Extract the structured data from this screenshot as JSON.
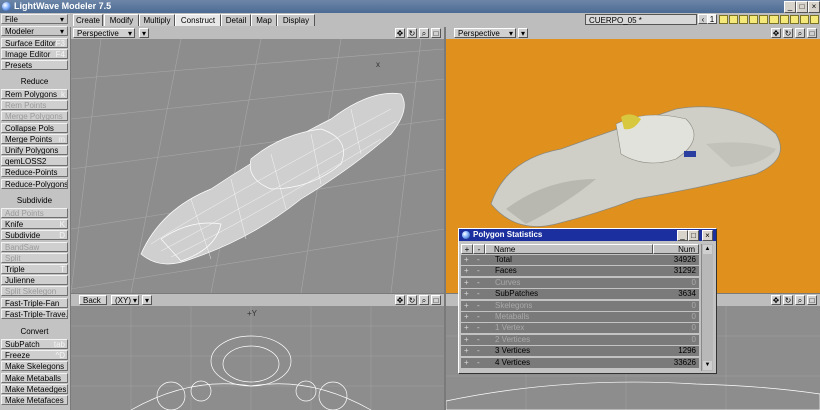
{
  "app": {
    "title": "LightWave Modeler 7.5"
  },
  "window_controls": [
    "_",
    "□",
    "×"
  ],
  "sidebar": {
    "file": "File",
    "modeler": "Modeler",
    "items": [
      {
        "label": "Surface Editor",
        "shortcut": "F3",
        "enabled": true
      },
      {
        "label": "Image Editor",
        "shortcut": "F4",
        "enabled": true
      },
      {
        "label": "Presets",
        "shortcut": "",
        "enabled": true
      }
    ],
    "sections": [
      {
        "title": "Reduce",
        "items": [
          {
            "label": "Rem Polygons",
            "shortcut": "k",
            "enabled": true
          },
          {
            "label": "Rem Points",
            "shortcut": "",
            "enabled": false
          },
          {
            "label": "Merge Polygons",
            "shortcut": "",
            "enabled": false
          },
          {
            "label": "Collapse Pols",
            "shortcut": "",
            "enabled": true
          },
          {
            "label": "Merge Points",
            "shortcut": "m",
            "enabled": true
          },
          {
            "label": "Unify Polygons",
            "shortcut": "",
            "enabled": true
          },
          {
            "label": "qemLOSS2",
            "shortcut": "",
            "enabled": true
          },
          {
            "label": "Reduce-Points",
            "shortcut": "",
            "enabled": true
          },
          {
            "label": "Reduce-Polygons",
            "shortcut": "",
            "enabled": true
          }
        ]
      },
      {
        "title": "Subdivide",
        "items": [
          {
            "label": "Add Points",
            "shortcut": "",
            "enabled": false
          },
          {
            "label": "Knife",
            "shortcut": "K",
            "enabled": true
          },
          {
            "label": "Subdivide",
            "shortcut": "D",
            "enabled": true
          },
          {
            "label": "BandSaw",
            "shortcut": "",
            "enabled": false
          },
          {
            "label": "Split",
            "shortcut": "",
            "enabled": false
          },
          {
            "label": "Triple",
            "shortcut": "T",
            "enabled": true
          },
          {
            "label": "Julienne",
            "shortcut": "",
            "enabled": true
          },
          {
            "label": "Split Skelegon",
            "shortcut": "",
            "enabled": false
          },
          {
            "label": "Fast-Triple-Fan",
            "shortcut": "",
            "enabled": true
          },
          {
            "label": "Fast-Triple-Trave...",
            "shortcut": "",
            "enabled": true
          }
        ]
      },
      {
        "title": "Convert",
        "items": [
          {
            "label": "SubPatch",
            "shortcut": "tab",
            "enabled": true
          },
          {
            "label": "Freeze",
            "shortcut": "^D",
            "enabled": true
          },
          {
            "label": "Make Skelegons",
            "shortcut": "",
            "enabled": true
          },
          {
            "label": "Make Metaballs",
            "shortcut": "",
            "enabled": true
          },
          {
            "label": "Make Metaedges",
            "shortcut": "",
            "enabled": true
          },
          {
            "label": "Make Metafaces",
            "shortcut": "",
            "enabled": true
          }
        ]
      }
    ]
  },
  "tabs": [
    "Create",
    "Modify",
    "Multiply",
    "Construct",
    "Detail",
    "Map",
    "Display"
  ],
  "active_tab": "Construct",
  "object_selector": "CUERPO_05 *",
  "layer_number": "1",
  "viewports": [
    {
      "view": "Perspective",
      "axis": ""
    },
    {
      "view": "Perspective",
      "axis": ""
    },
    {
      "view": "Back",
      "axis": "(XY)"
    },
    {
      "view": "",
      "axis": ""
    }
  ],
  "axis_labels": {
    "x": "x",
    "y": "+Y"
  },
  "colors": {
    "render_bg": "#e0901c",
    "dialog_title": "#1b2f9e",
    "layer_yellow": "#f5e97a"
  },
  "polygon_stats": {
    "title": "Polygon Statistics",
    "headers": {
      "name": "Name",
      "num": "Num"
    },
    "rows": [
      {
        "name": "Total",
        "num": "34926",
        "enabled": true
      },
      {
        "name": "Faces",
        "num": "31292",
        "enabled": true
      },
      {
        "name": "Curves",
        "num": "0",
        "enabled": false
      },
      {
        "name": "SubPatches",
        "num": "3634",
        "enabled": true
      },
      {
        "name": "Skelegons",
        "num": "0",
        "enabled": false
      },
      {
        "name": "Metaballs",
        "num": "0",
        "enabled": false
      },
      {
        "name": "1 Vertex",
        "num": "0",
        "enabled": false
      },
      {
        "name": "2 Vertices",
        "num": "0",
        "enabled": false
      },
      {
        "name": "3 Vertices",
        "num": "1296",
        "enabled": true
      },
      {
        "name": "4 Vertices",
        "num": "33626",
        "enabled": true
      }
    ]
  },
  "icons": [
    "move-icon",
    "rotate-icon",
    "zoom-icon",
    "maximize-icon",
    "dropdown-icon"
  ]
}
